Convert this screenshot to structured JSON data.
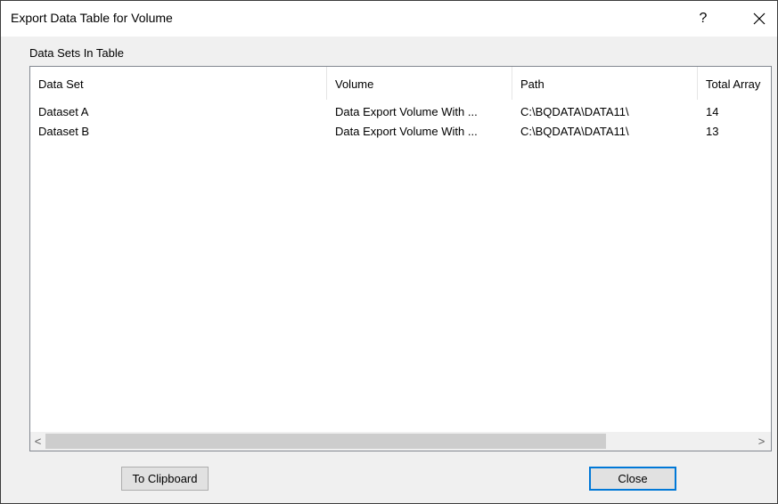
{
  "window": {
    "title": "Export Data Table for Volume",
    "help_glyph": "?",
    "close_icon": "close-x-icon"
  },
  "group": {
    "label": "Data Sets In Table"
  },
  "table": {
    "columns": [
      "Data Set",
      "Volume",
      "Path",
      "Total Array"
    ],
    "rows": [
      [
        "Dataset A",
        "Data Export Volume With ...",
        "C:\\BQDATA\\DATA11\\",
        "14"
      ],
      [
        "Dataset B",
        "Data Export Volume With ...",
        "C:\\BQDATA\\DATA11\\",
        "13"
      ]
    ]
  },
  "scrollbar": {
    "left_arrow": "<",
    "right_arrow": ">"
  },
  "buttons": {
    "clipboard_label": "To Clipboard",
    "close_label": "Close"
  },
  "colors": {
    "default_button_border": "#0078d7",
    "dialog_background": "#f0f0f0"
  }
}
